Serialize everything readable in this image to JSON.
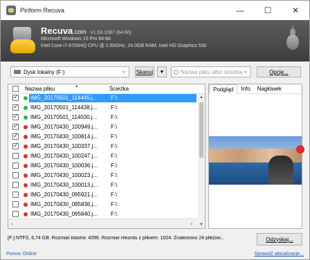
{
  "window": {
    "title": "Piriform Recuva",
    "minimize_glyph": "—",
    "maximize_glyph": "☐",
    "close_glyph": "✕"
  },
  "header": {
    "brand": "Recuva",
    "brand_suffix": ".com",
    "version": "v1.53.1087 (64-bit)",
    "os_line": "Microsoft Windows 10 Pro 64-bit",
    "hw_line": "Intel Core i7-6700HQ CPU @ 2.60GHz, 24.0GB RAM, Intel HD Graphics 530"
  },
  "toolbar": {
    "drive_label": "Dysk lokalny (F:)",
    "scan_label": "Skanuj",
    "search_placeholder": "Nazwa pliku albo ścieżka",
    "options_label": "Opcje..."
  },
  "list": {
    "col_name": "Nazwa pliku",
    "col_path": "Ścieżka",
    "sort_glyph": "▲",
    "rows": [
      {
        "name": "IMG_20170501_114445.j...",
        "path": "F:\\",
        "state": "green",
        "checked": true,
        "selected": true
      },
      {
        "name": "IMG_20170501_114438.j...",
        "path": "F:\\",
        "state": "green",
        "checked": true,
        "selected": false
      },
      {
        "name": "IMG_20170501_114030.j...",
        "path": "F:\\",
        "state": "green",
        "checked": true,
        "selected": false
      },
      {
        "name": "IMG_20170430_100949.j...",
        "path": "F:\\",
        "state": "red",
        "checked": true,
        "selected": false
      },
      {
        "name": "IMG_20170430_100814.j...",
        "path": "F:\\",
        "state": "red",
        "checked": true,
        "selected": false
      },
      {
        "name": "IMG_20170430_100337.j...",
        "path": "F:\\",
        "state": "red",
        "checked": true,
        "selected": false
      },
      {
        "name": "IMG_20170430_100247.j...",
        "path": "F:\\",
        "state": "red",
        "checked": false,
        "selected": false
      },
      {
        "name": "IMG_20170430_100036.j...",
        "path": "F:\\",
        "state": "red",
        "checked": false,
        "selected": false
      },
      {
        "name": "IMG_20170430_100023.j...",
        "path": "F:\\",
        "state": "red",
        "checked": false,
        "selected": false
      },
      {
        "name": "IMG_20170430_100013.j...",
        "path": "F:\\",
        "state": "red",
        "checked": false,
        "selected": false
      },
      {
        "name": "IMG_20170430_095921.j...",
        "path": "F:\\",
        "state": "red",
        "checked": false,
        "selected": false
      },
      {
        "name": "IMG_20170430_095836.j...",
        "path": "F:\\",
        "state": "red",
        "checked": false,
        "selected": false
      },
      {
        "name": "IMG_20170430_095640.j...",
        "path": "F:\\",
        "state": "red",
        "checked": false,
        "selected": false
      }
    ]
  },
  "preview": {
    "tabs": [
      "Podgląd",
      "Info",
      "Nagłówek"
    ],
    "active_tab": 0
  },
  "status": {
    "text": "[F:] NTFS, 6,74 GB. Rozmiar klastra: 4096. Rozmiar rekordu z plikiem: 1024. Znaleziono 24 plik(ów...",
    "recover_label": "Odzyskaj..."
  },
  "footer": {
    "help_link": "Pomoc Online",
    "update_link": "Sprawdź aktualizacje..."
  },
  "colors": {
    "selection": "#3399ff",
    "state_green": "#2eb84a",
    "state_red": "#e0302a",
    "link": "#1a5fb4"
  }
}
